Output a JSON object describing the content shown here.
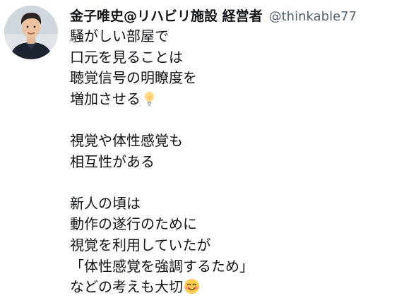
{
  "tweet": {
    "author": {
      "display_name": "金子唯史@リハビリ施設 経営者",
      "handle": "@thinkable77",
      "avatar_icon": "user-avatar-photo"
    },
    "paragraphs": [
      {
        "lines": [
          "騒がしい部屋で",
          "口元を見ることは",
          "聴覚信号の明瞭度を",
          "増加させる"
        ],
        "trailing_emoji": "light-bulb-icon"
      },
      {
        "lines": [
          "視覚や体性感覚も",
          "相互性がある"
        ]
      },
      {
        "lines": [
          "新人の頃は",
          "動作の遂行のために",
          "視覚を利用していたが",
          "「体性感覚を強調するため」",
          "などの考えも大切"
        ],
        "trailing_emoji": "smiling-face-icon"
      }
    ]
  },
  "colors": {
    "text": "#0f1419",
    "handle": "#536471",
    "background": "#ffffff"
  }
}
